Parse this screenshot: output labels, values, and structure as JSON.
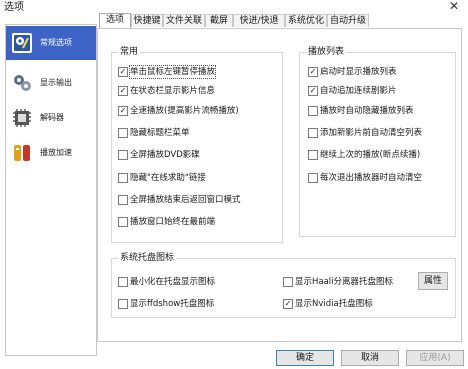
{
  "window": {
    "title": "选项",
    "close_glyph": "✕"
  },
  "sidebar": {
    "items": [
      {
        "label": "常规选项",
        "icon": "general-settings-icon",
        "color": "#2a56a6"
      },
      {
        "label": "显示输出",
        "icon": "display-output-icon",
        "color": "#5a6b8a"
      },
      {
        "label": "解码器",
        "icon": "decoder-icon",
        "color": "#666666"
      },
      {
        "label": "播放加速",
        "icon": "playback-acceleration-icon",
        "color": "#e2a21a"
      }
    ],
    "active_index": 0
  },
  "tabs": [
    {
      "label": "选项"
    },
    {
      "label": "快捷键"
    },
    {
      "label": "文件关联"
    },
    {
      "label": "截屏"
    },
    {
      "label": "快进/快退"
    },
    {
      "label": "系统优化"
    },
    {
      "label": "自动升级"
    }
  ],
  "common": {
    "title": "常用",
    "options": [
      {
        "label": "单击鼠标左键暂停播放",
        "checked": true
      },
      {
        "label": "在状态栏显示影片信息",
        "checked": true
      },
      {
        "label": "全速播放(提高影片流畅播放)",
        "checked": true
      },
      {
        "label": "隐藏标题栏菜单",
        "checked": false
      },
      {
        "label": "全屏播放DVD影碟",
        "checked": false
      },
      {
        "label": "隐藏\"在线求助\"链接",
        "checked": false
      },
      {
        "label": "全屏播放结束后返回窗口模式",
        "checked": false
      },
      {
        "label": "播放窗口始终在最前端",
        "checked": false
      }
    ]
  },
  "playlist": {
    "title": "播放列表",
    "options": [
      {
        "label": "启动时显示播放列表",
        "checked": true
      },
      {
        "label": "自动追加连续剧影片",
        "checked": true
      },
      {
        "label": "播放时自动隐藏播放列表",
        "checked": false
      },
      {
        "label": "添加新影片前自动清空列表",
        "checked": false
      },
      {
        "label": "继续上次的播放(断点续播)",
        "checked": false
      },
      {
        "label": "每次退出播放器时自动清空",
        "checked": false
      }
    ]
  },
  "tray": {
    "title": "系统托盘图标",
    "options": [
      {
        "label": "最小化在托盘显示图标",
        "checked": false
      },
      {
        "label": "显示Haali分离器托盘图标",
        "checked": false
      },
      {
        "label": "显示ffdshow托盘图标",
        "checked": false
      },
      {
        "label": "显示Nvidia托盘图标",
        "checked": true
      }
    ],
    "properties_button": "属性"
  },
  "footer": {
    "ok": "确定",
    "cancel": "取消",
    "apply": "应用(A)"
  },
  "colors": {
    "accent": "#3e63c6",
    "border": "#c9c9c9",
    "button_face": "#e6e6e6"
  }
}
